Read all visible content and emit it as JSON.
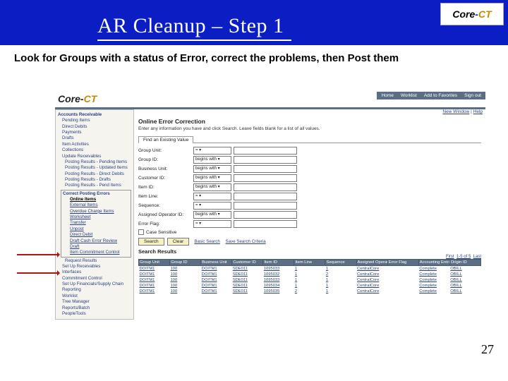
{
  "slide": {
    "title": "AR Cleanup – Step 1",
    "brand": {
      "core": "Core",
      "dash": "-",
      "ct": "CT"
    },
    "instruction": "Look for Groups with a status of Error, correct the problems, then Post them",
    "page_num": "27"
  },
  "top_links": [
    "Home",
    "Worklist",
    "Add to Favorites",
    "Sign out"
  ],
  "nw_help": {
    "new_window": "New Window",
    "help": "Help"
  },
  "sidebar": {
    "head": "Accounts Receivable",
    "groups": [
      "Pending Items",
      "Direct Debits",
      "Payments",
      "Drafts",
      "Item Activities",
      "Collections",
      "Update Receivables",
      "Posting Results - Pending Items",
      "Posting Results - Updated Items",
      "Posting Results - Direct Debits",
      "Posting Results - Drafts",
      "Posting Results - Pend Items"
    ],
    "submenu_label": "Correct Posting Errors",
    "submenu": [
      "Online Items",
      "External Items",
      "Overdue Charge Items",
      "Worksheet",
      "Transfer",
      "Unpost",
      "Direct Debit",
      "Draft Cash Error Review",
      "Draft",
      "Item Commitment Control"
    ],
    "tail": [
      "Request Results",
      "Set Up Receivables",
      "Interfaces",
      "Commitment Control",
      "Set Up Financials/Supply Chain",
      "Reporting",
      "Worklist",
      "Tree Manager",
      "Reports/Batch",
      "PeopleTools"
    ]
  },
  "section": {
    "title": "Online Error Correction",
    "sub": "Enter any information you have and click Search. Leave fields blank for a list of all values.",
    "tab": "Find an Existing Value"
  },
  "fields": [
    {
      "label": "Group Unit:",
      "op": "=",
      "val": ""
    },
    {
      "label": "Group ID:",
      "op": "begins with",
      "val": ""
    },
    {
      "label": "Business Unit:",
      "op": "begins with",
      "val": ""
    },
    {
      "label": "Customer ID:",
      "op": "begins with",
      "val": ""
    },
    {
      "label": "Item ID:",
      "op": "begins with",
      "val": ""
    },
    {
      "label": "Item Line:",
      "op": "=",
      "val": ""
    },
    {
      "label": "Sequence:",
      "op": "=",
      "val": ""
    },
    {
      "label": "Assigned Operator ID:",
      "op": "begins with",
      "val": ""
    },
    {
      "label": "Error Flag:",
      "op": "=",
      "val": ""
    }
  ],
  "case_sensitive_label": "Case Sensitive",
  "buttons": {
    "search": "Search",
    "clear": "Clear"
  },
  "links": {
    "basic": "Basic Search",
    "save": "Save Search Criteria"
  },
  "results": {
    "title": "Search Results",
    "nav": {
      "first": "First",
      "range": "1-5 of 5",
      "last": "Last"
    },
    "cols": [
      "Group Unit",
      "Group ID",
      "Business Unit",
      "Customer ID",
      "Item ID",
      "Item Line",
      "Sequence",
      "Assigned Operator",
      "Error Flag",
      "Accounting Entries",
      "Origin ID"
    ],
    "rows": [
      [
        "DOITM1",
        "100",
        "DOITM1",
        "SDE011",
        "1095033",
        "1",
        "1",
        "CentralCore",
        " ",
        "Complete",
        "OBILL"
      ],
      [
        "DOITM1",
        "100",
        "DOITM1",
        "SDE011",
        "1095032",
        "1",
        "2",
        "CentralCore",
        " ",
        "Complete",
        "OBILL"
      ],
      [
        "DOITM1",
        "100",
        "DOITM1",
        "SDE011",
        "1095033",
        "1",
        "1",
        "CentralCore",
        " ",
        "Complete",
        "OBILL"
      ],
      [
        "DOITM1",
        "100",
        "DOITM1",
        "SDE011",
        "1095034",
        "1",
        "1",
        "CentralCore",
        " ",
        "Complete",
        "OBILL"
      ],
      [
        "DOITM1",
        "100",
        "DOITM1",
        "SDE011",
        "1095035",
        "2",
        "1",
        "CentralCore",
        " ",
        "Complete",
        "OBILL"
      ]
    ]
  }
}
